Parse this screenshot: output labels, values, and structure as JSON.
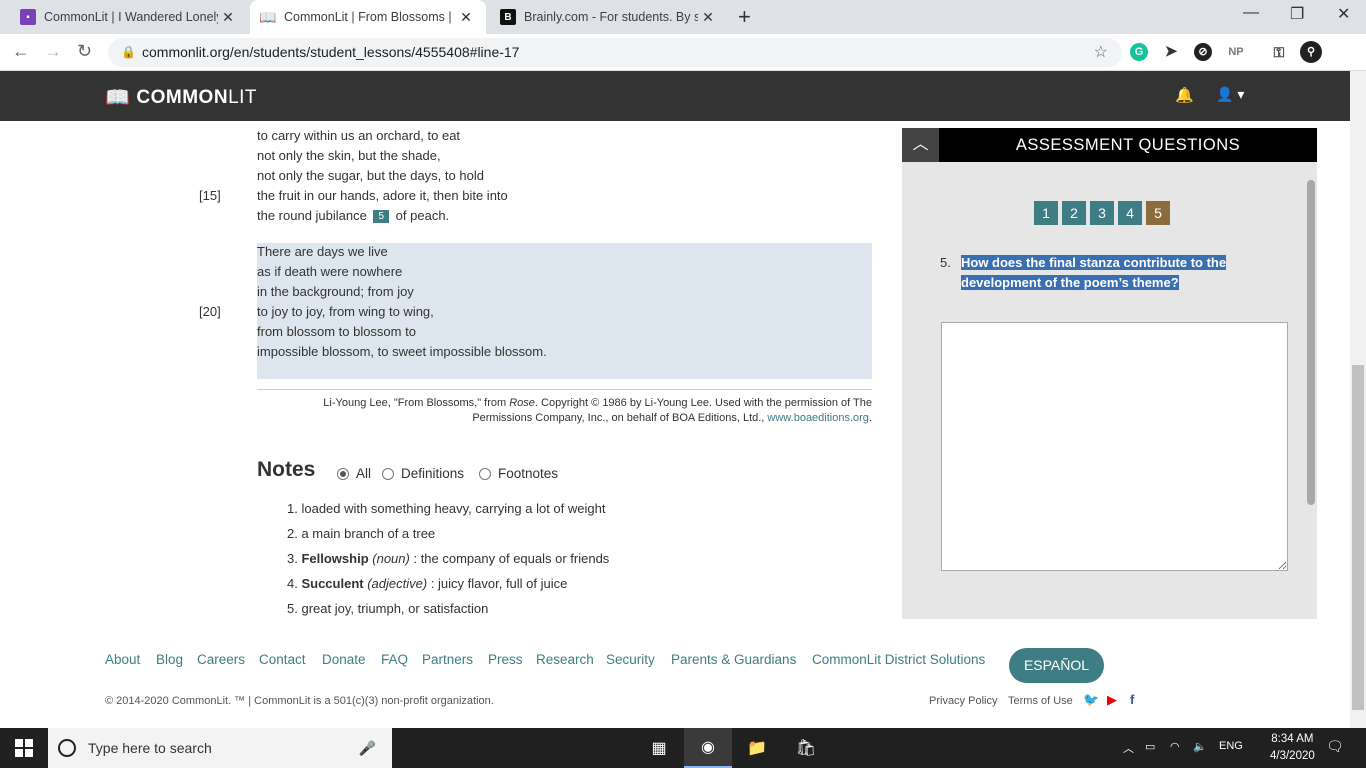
{
  "browser": {
    "tabs": [
      {
        "title": "CommonLit | I Wandered Lonely a",
        "active": false
      },
      {
        "title": "CommonLit | From Blossoms | Fre",
        "active": true
      },
      {
        "title": "Brainly.com - For students. By stu",
        "active": false
      }
    ],
    "url": "commonlit.org/en/students/student_lessons/4555408#line-17",
    "ext_np": "NP"
  },
  "header": {
    "logo_bold": "COMMON",
    "logo_light": "LIT"
  },
  "poem": {
    "lines_top": [
      "to carry within us an orchard, to eat",
      "not only the skin, but the shade,",
      "not only the sugar, but the days, to hold",
      "the fruit in our hands, adore it, then bite into"
    ],
    "line_round_pre": "the round jubilance",
    "line_round_badge": "5",
    "line_round_post": "of peach.",
    "line_num_15": "[15]",
    "lines_stanza": [
      "There are days we live",
      "as if death were nowhere",
      "in the background; from joy",
      "to joy to joy, from wing to wing,",
      "from blossom to blossom to",
      "impossible blossom, to sweet impossible blossom."
    ],
    "line_num_20": "[20]",
    "citation_a": "Li-Young Lee, \"From Blossoms,\" from ",
    "citation_title": "Rose",
    "citation_b": ". Copyright © 1986 by Li-Young Lee. Used with the permission of The",
    "citation_c": "Permissions Company, Inc., on behalf of BOA Editions, Ltd., ",
    "citation_link": "www.boaeditions.org",
    "citation_end": "."
  },
  "notes": {
    "title": "Notes",
    "filters": [
      "All",
      "Definitions",
      "Footnotes"
    ],
    "selected": "All",
    "items": [
      {
        "num": "1.",
        "term": "",
        "pos": "",
        "text": "loaded with something heavy, carrying a lot of weight"
      },
      {
        "num": "2.",
        "term": "",
        "pos": "",
        "text": "a main branch of a tree"
      },
      {
        "num": "3.",
        "term": "Fellowship",
        "pos": "(noun)",
        "text": ": the company of equals or friends"
      },
      {
        "num": "4.",
        "term": "Succulent",
        "pos": "(adjective)",
        "text": ": juicy flavor, full of juice"
      },
      {
        "num": "5.",
        "term": "",
        "pos": "",
        "text": "great joy, triumph, or satisfaction"
      }
    ]
  },
  "assessment": {
    "title": "ASSESSMENT QUESTIONS",
    "question_buttons": [
      "1",
      "2",
      "3",
      "4",
      "5"
    ],
    "current": "5",
    "question_number": "5.",
    "question_line1": "How does the final stanza contribute to the",
    "question_line2": "development of the poem’s theme?",
    "answer_value": ""
  },
  "footer": {
    "links": [
      "About",
      "Blog",
      "Careers",
      "Contact",
      "Donate",
      "FAQ",
      "Partners",
      "Press",
      "Research",
      "Security",
      "Parents & Guardians",
      "CommonLit District Solutions"
    ],
    "espanol": "ESPAÑOL",
    "copyright": "© 2014-2020 CommonLit. ™ | CommonLit is a 501(c)(3) non-profit organization.",
    "privacy": "Privacy Policy",
    "terms": "Terms of Use"
  },
  "taskbar": {
    "search_placeholder": "Type here to search",
    "lang": "ENG",
    "time": "8:34 AM",
    "date": "4/3/2020"
  },
  "colors": {
    "accent": "#3f7d84",
    "header_bg": "#333333",
    "current_question": "#8a6d3b"
  }
}
